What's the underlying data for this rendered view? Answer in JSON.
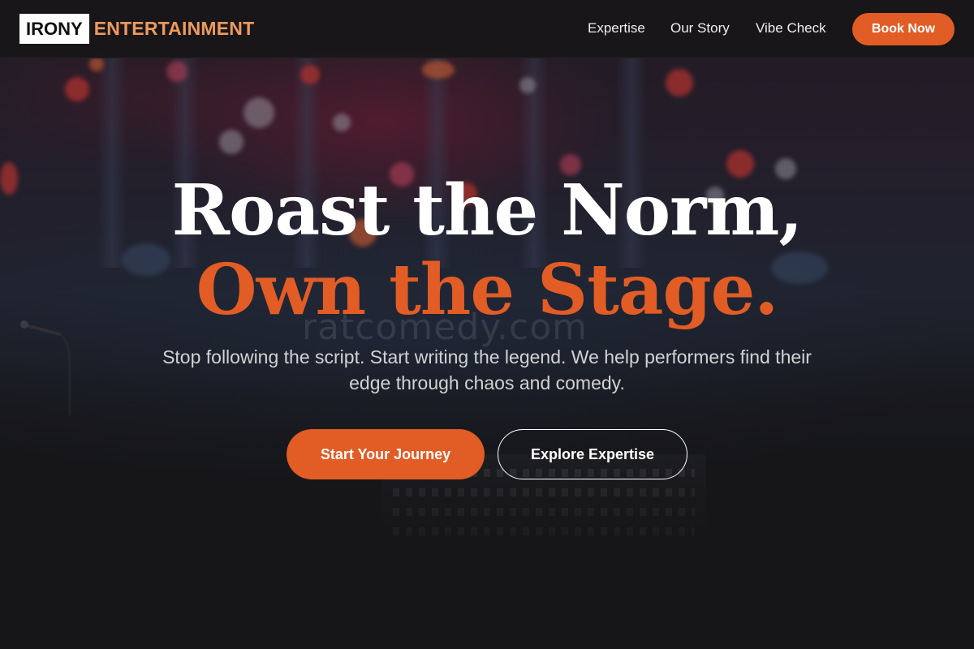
{
  "header": {
    "logo": {
      "box_text": "IRONY",
      "text": "ENTERTAINMENT"
    },
    "nav": [
      {
        "label": "Expertise"
      },
      {
        "label": "Our Story"
      },
      {
        "label": "Vibe Check"
      }
    ],
    "cta_label": "Book Now"
  },
  "hero": {
    "headline_line1": "Roast the Norm,",
    "headline_line2": "Own the Stage.",
    "subtitle": "Stop following the script. Start writing the legend. We help performers find their edge through chaos and comedy.",
    "primary_button": "Start Your Journey",
    "secondary_button": "Explore Expertise"
  },
  "background": {
    "watermark": "ratcomedy.com"
  },
  "colors": {
    "accent": "#e25c25",
    "logo_accent": "#ee9a5e",
    "background": "#161618",
    "text": "#ffffff"
  }
}
